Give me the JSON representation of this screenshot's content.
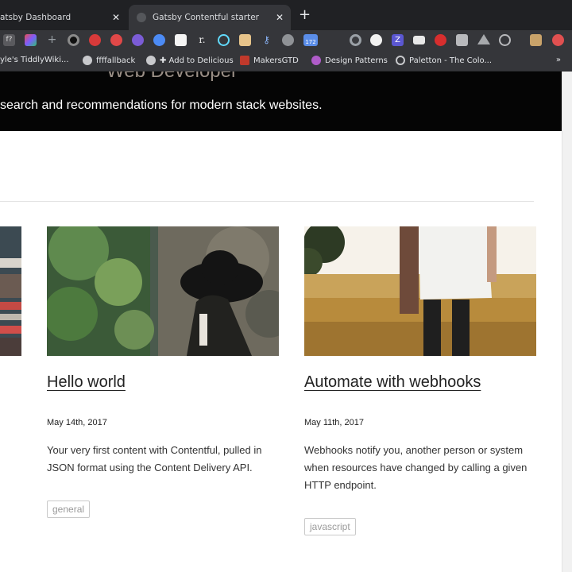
{
  "browser": {
    "tabs": [
      {
        "title": "Gatsby Dashboard",
        "displayed_title": "atsby Dashboard",
        "close": "✕",
        "active": false
      },
      {
        "title": "Gatsby Contentful starter",
        "close": "✕",
        "active": true
      }
    ],
    "new_tab": "+",
    "extensions": [
      "fx-icon",
      "colorful-icon",
      "plus-icon",
      "eye-icon",
      "red-circle-icon",
      "red-badge-icon",
      "purple-c-icon",
      "blue-speech-icon",
      "bookmark-i-icon",
      "readability-r-icon",
      "react-atom-icon",
      "envelope-icon",
      "key-icon",
      "gray-circle-icon",
      "calendar-icon",
      "gray-dot-icon",
      "white-dot-icon",
      "purple-z-icon",
      "folder-icon",
      "red-glasses-icon",
      "monitor-icon",
      "drive-icon",
      "check-circle-icon",
      "avatar-icon",
      "red-dot-icon"
    ],
    "calendar_badge": "172",
    "bookmarks": [
      {
        "label": "yle's TiddlyWiki...",
        "icon": "wiki-icon"
      },
      {
        "label": "ffffallback",
        "icon": "globe-icon"
      },
      {
        "label": "✚ Add to Delicious",
        "icon": "globe-icon"
      },
      {
        "label": "MakersGTD",
        "icon": "makers-icon"
      },
      {
        "label": "Design Patterns",
        "icon": "patterns-icon"
      },
      {
        "label": "Paletton - The Colo...",
        "icon": "paletton-icon"
      }
    ],
    "more_bookmarks": "»"
  },
  "page": {
    "hero": {
      "title": "Web Developer",
      "tagline": "search and recommendations for modern stack websites."
    },
    "cards": [
      {
        "title": "Hello world",
        "date": "May 14th, 2017",
        "description": "Your very first content with Contentful, pulled in JSON format using the Content Delivery API.",
        "tag": "general"
      },
      {
        "title": "Automate with webhooks",
        "date": "May 11th, 2017",
        "description": "Webhooks notify you, another person or system when resources have changed by calling a given HTTP endpoint.",
        "tag": "javascript"
      }
    ]
  }
}
